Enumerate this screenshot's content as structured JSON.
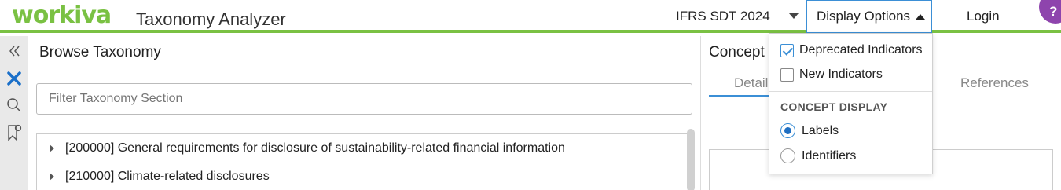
{
  "header": {
    "logo_text": "workiva",
    "app_title": "Taxonomy Analyzer",
    "taxonomy_selected": "IFRS SDT 2024",
    "display_options_label": "Display Options",
    "login_label": "Login",
    "help_label": "?"
  },
  "colors": {
    "brand_green": "#7ac143",
    "accent_blue": "#3b8fd6",
    "help_purple": "#8e44ad"
  },
  "rail": {
    "icons": [
      "collapse-icon",
      "xbrl-icon",
      "search-icon",
      "bookmark-icon"
    ]
  },
  "browse": {
    "title": "Browse Taxonomy",
    "filter_placeholder": "Filter Taxonomy Section",
    "sections": [
      "[200000] General requirements for disclosure of sustainability-related financial information",
      "[210000] Climate-related disclosures"
    ]
  },
  "concept": {
    "title": "Concept",
    "tabs": [
      "Details",
      "References"
    ]
  },
  "display_options_menu": {
    "items": [
      {
        "label": "Deprecated Indicators",
        "checked": true
      },
      {
        "label": "New Indicators",
        "checked": false
      }
    ],
    "section_header": "CONCEPT DISPLAY",
    "radios": [
      {
        "label": "Labels",
        "selected": true
      },
      {
        "label": "Identifiers",
        "selected": false
      }
    ]
  }
}
